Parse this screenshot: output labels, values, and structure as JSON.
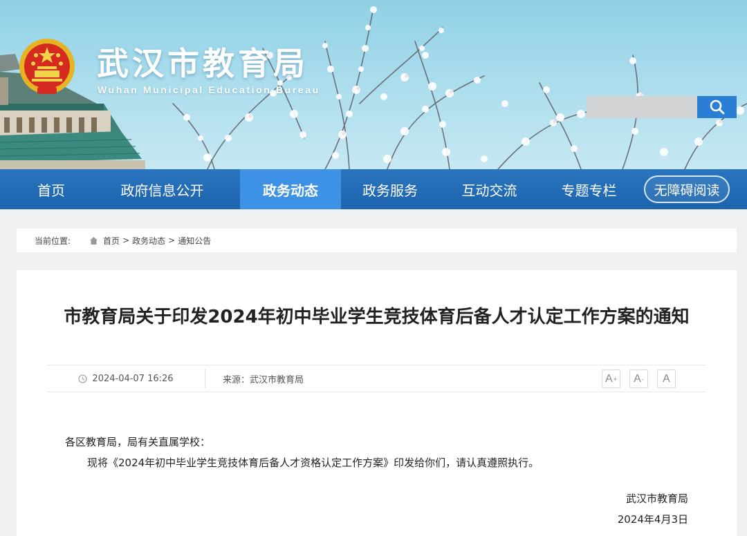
{
  "site": {
    "title": "武汉市教育局",
    "subtitle": "Wuhan Municipal Education Bureau",
    "emblem_icon": "national-emblem-icon"
  },
  "search": {
    "placeholder": "",
    "button_icon": "search-icon"
  },
  "nav": {
    "items": [
      {
        "label": "首页",
        "active": false
      },
      {
        "label": "政府信息公开",
        "active": false
      },
      {
        "label": "政务动态",
        "active": true
      },
      {
        "label": "政务服务",
        "active": false
      },
      {
        "label": "互动交流",
        "active": false
      },
      {
        "label": "专题专栏",
        "active": false
      }
    ],
    "accessibility_label": "无障碍阅读"
  },
  "breadcrumb": {
    "label": "当前位置:",
    "items": [
      "首页",
      "政务动态",
      "通知公告"
    ],
    "separator": ">"
  },
  "article": {
    "title": "市教育局关于印发2024年初中毕业学生竞技体育后备人才认定工作方案的通知",
    "time": "2024-04-07 16:26",
    "source": "来源：武汉市教育局",
    "font_buttons": {
      "increase": "A",
      "decrease": "A",
      "reset": "A"
    },
    "salutation": "各区教育局，局有关直属学校：",
    "body": "现将《2024年初中毕业学生竞技体育后备人才资格认定工作方案》印发给你们，请认真遵照执行。",
    "signature_org": "武汉市教育局",
    "signature_date": "2024年4月3日"
  },
  "colors": {
    "nav_bg": "#1d63ad",
    "nav_active": "#3d92e6",
    "search_button": "#2a7fd4",
    "sky": "#a9dcec"
  }
}
